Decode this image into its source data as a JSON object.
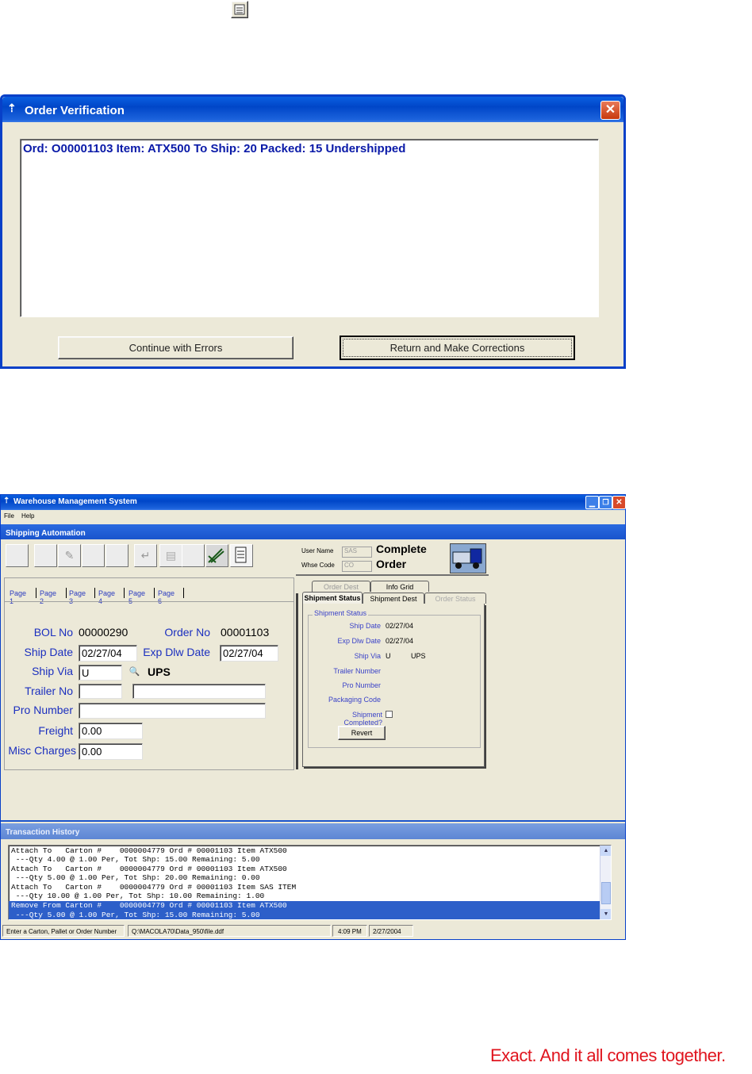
{
  "dialog": {
    "title": "Order Verification",
    "message": "Ord: O00001103 Item: ATX500 To Ship: 20 Packed: 15 Undershipped",
    "continue_label": "Continue with Errors",
    "return_label": "Return and Make Corrections"
  },
  "main_window": {
    "title": "Warehouse Management System",
    "menu": [
      "File",
      "Help"
    ],
    "panel_title": "Shipping Automation",
    "user_name_label": "User Name",
    "user_name_value": "SAS",
    "whse_code_label": "Whse Code",
    "whse_code_value": "CO",
    "status_line1": "Complete",
    "status_line2": "Order",
    "pages": [
      "Page 1",
      "Page 2",
      "Page 3",
      "Page 4",
      "Page 5",
      "Page 6"
    ],
    "form": {
      "bol_no_label": "BOL No",
      "bol_no_value": "00000290",
      "order_no_label": "Order No",
      "order_no_value": "00001103",
      "ship_date_label": "Ship Date",
      "ship_date_value": "02/27/04",
      "exp_dlw_date_label": "Exp Dlw Date",
      "exp_dlw_date_value": "02/27/04",
      "ship_via_label": "Ship Via",
      "ship_via_value": "U",
      "ship_via_name": "UPS",
      "trailer_no_label": "Trailer No",
      "pro_number_label": "Pro Number",
      "freight_label": "Freight",
      "freight_value": "0.00",
      "misc_charges_label": "Misc Charges",
      "misc_charges_value": "0.00"
    },
    "right_tabs": {
      "top": [
        "Order Dest",
        "Info Grid"
      ],
      "bottom": [
        "Shipment Status",
        "Shipment Dest",
        "Order Status"
      ],
      "group_label": "Shipment Status",
      "ship_date_label": "Ship Date",
      "ship_date_value": "02/27/04",
      "exp_dlw_date_label": "Exp Dlw Date",
      "exp_dlw_date_value": "02/27/04",
      "ship_via_label": "Ship Via",
      "ship_via_code": "U",
      "ship_via_name": "UPS",
      "trailer_number_label": "Trailer Number",
      "pro_number_label": "Pro Number",
      "packaging_code_label": "Packaging Code",
      "shipment_completed_label": "Shipment Completed?",
      "revert_label": "Revert"
    },
    "history_title": "Transaction History",
    "history_lines": [
      "Attach To   Carton #    0000004779 Ord # 00001103 Item ATX500",
      " ---Qty 4.00 @ 1.00 Per, Tot Shp: 15.00 Remaining: 5.00",
      "Attach To   Carton #    0000004779 Ord # 00001103 Item ATX500",
      " ---Qty 5.00 @ 1.00 Per, Tot Shp: 20.00 Remaining: 0.00",
      "Attach To   Carton #    0000004779 Ord # 00001103 Item SAS ITEM",
      " ---Qty 10.00 @ 1.00 Per, Tot Shp: 10.00 Remaining: 1.00",
      "Remove From Carton #    0000004779 Ord # 00001103 Item ATX500",
      " ---Qty 5.00 @ 1.00 Per, Tot Shp: 15.00 Remaining: 5.00"
    ],
    "status_bar": {
      "prompt": "Enter a Carton, Pallet or Order Number",
      "path": "Q:\\MACOLA70\\Data_950\\file.ddf",
      "time": "4:09 PM",
      "date": "2/27/2004"
    }
  },
  "tagline": "Exact. And it all comes together.",
  "colors": {
    "accent_red": "#e0141e",
    "label_blue": "#1b2fbf",
    "selection": "#2d5fc9"
  }
}
